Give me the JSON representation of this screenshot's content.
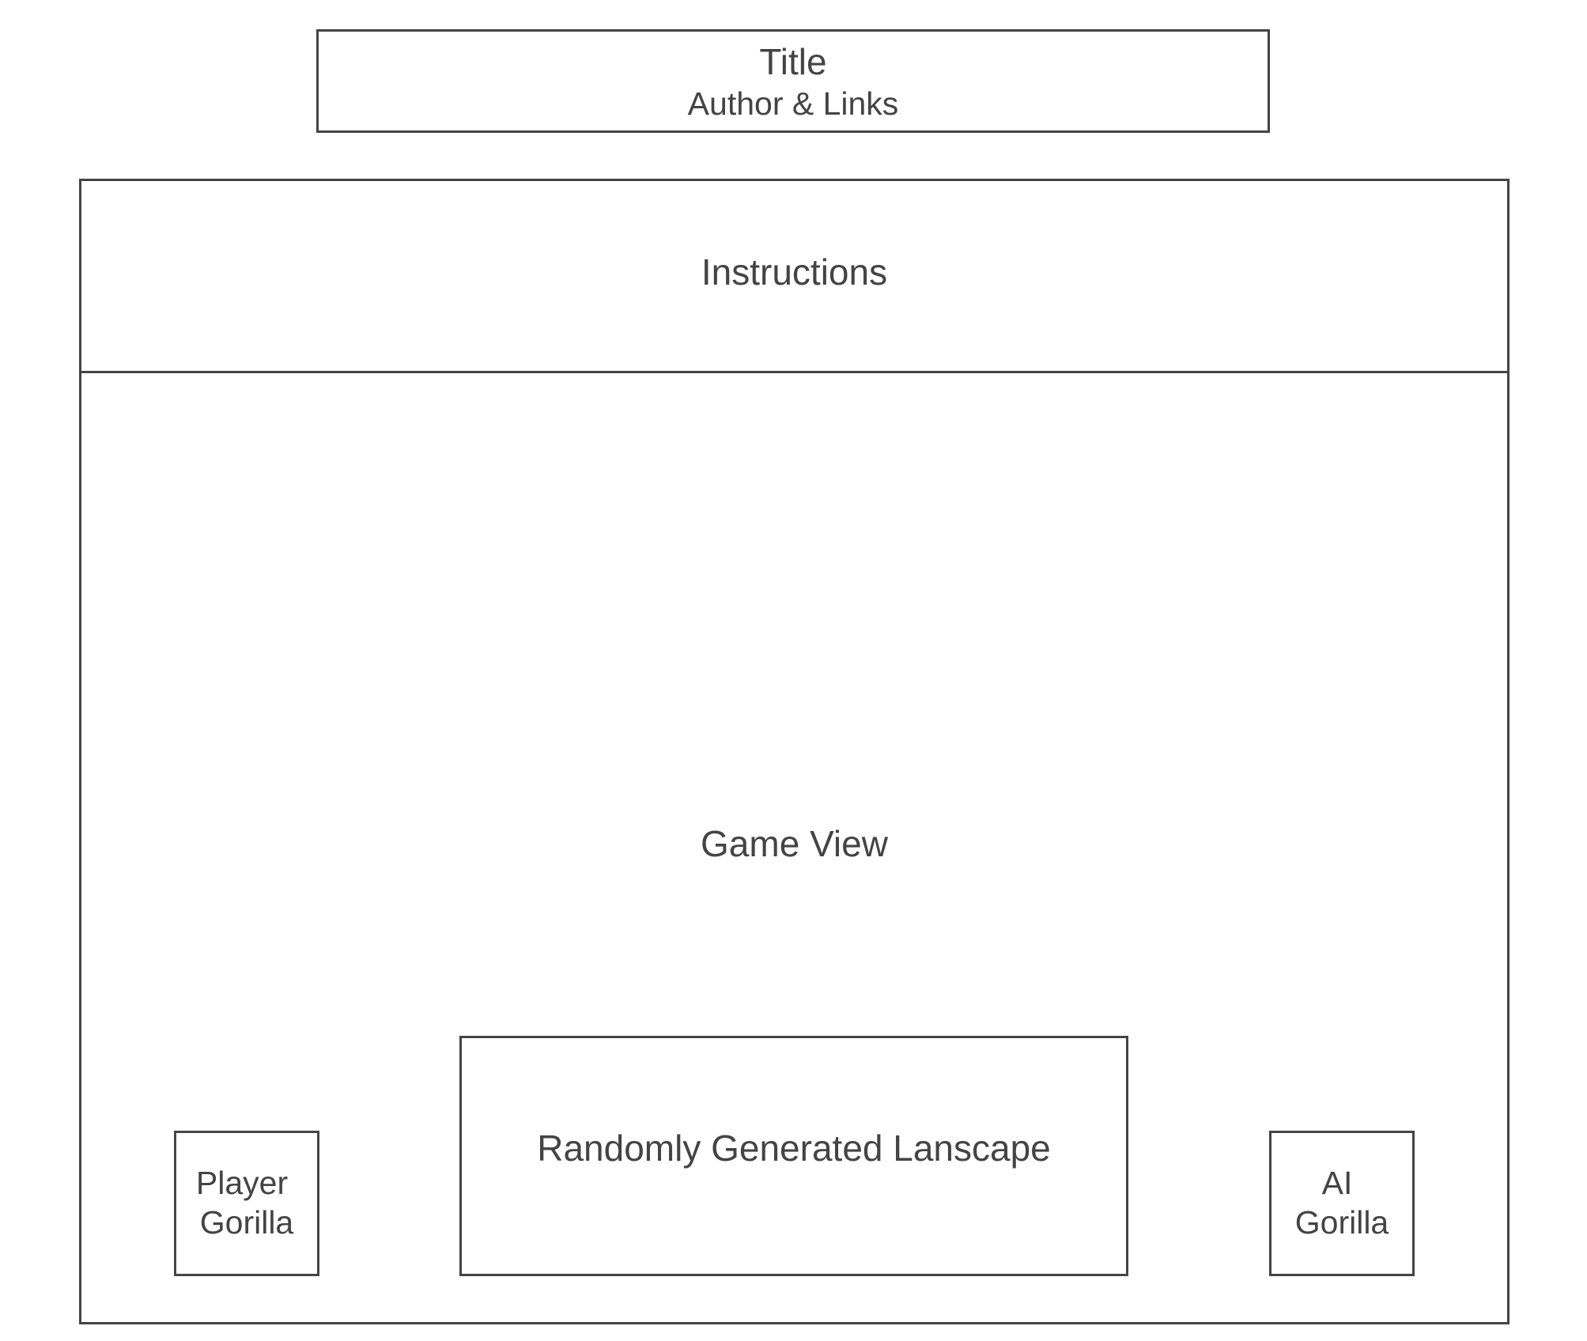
{
  "header": {
    "title": "Title",
    "subtitle": "Author & Links"
  },
  "instructions": {
    "label": "Instructions"
  },
  "game_view": {
    "label": "Game View",
    "landscape_label": "Randomly Generated Lanscape",
    "player_gorilla": {
      "line1": "Player",
      "line2": "Gorilla"
    },
    "ai_gorilla": {
      "line1": "AI",
      "line2": "Gorilla"
    }
  },
  "colors": {
    "stroke": "#444446",
    "text": "#444446",
    "background": "#ffffff"
  }
}
